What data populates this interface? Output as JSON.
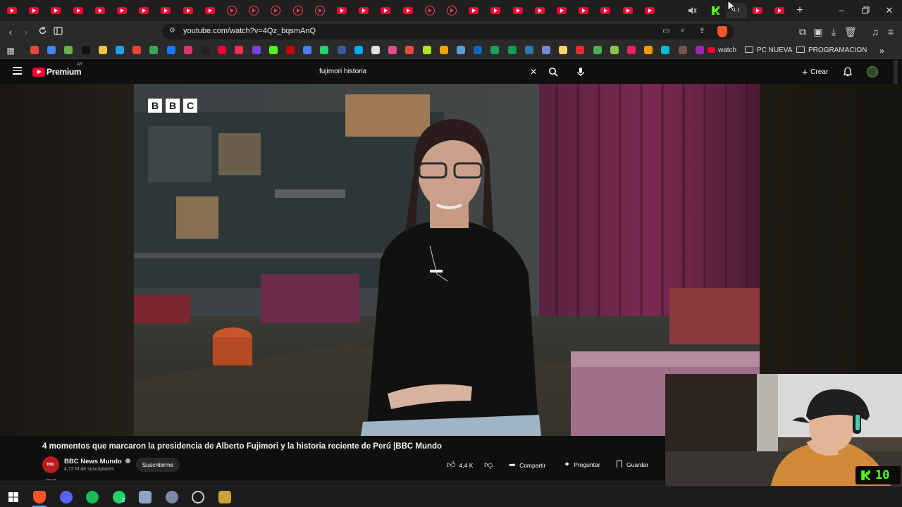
{
  "browser": {
    "active_tab_label": "4 r",
    "url": "youtube.com/watch?v=4Qz_bqsmAnQ",
    "bookmarks": {
      "watch_label": "watch",
      "folders": [
        "PC NUEVA",
        "PROGRAMACION"
      ]
    }
  },
  "youtube": {
    "logo_text": "Premium",
    "country_code": "AR",
    "search_query": "fujimori historia",
    "create_label": "Crear",
    "video": {
      "watermark_letters": [
        "B",
        "B",
        "C"
      ],
      "title": "4 momentos que marcaron la presidencia de Alberto Fujimori y la historia reciente de Perú |BBC Mundo"
    },
    "channel": {
      "name": "BBC News Mundo",
      "subscribers": "4,72 M de suscriptores",
      "avatar_text": "BBC NEWS"
    },
    "actions": {
      "subscribe": "Suscribirme",
      "likes": "4,4 K",
      "share": "Compartir",
      "ask": "Preguntar",
      "save": "Guardar"
    }
  },
  "overlay": {
    "kick_badge": "10"
  },
  "taskbar": {
    "whatsapp_badge": "2"
  },
  "colors": {
    "youtube_red": "#ff0033",
    "kick_green": "#53fc18",
    "page_bg": "#0f0f0f"
  }
}
